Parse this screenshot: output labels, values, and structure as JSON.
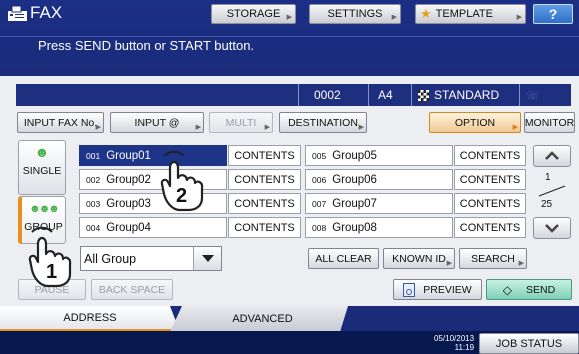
{
  "header": {
    "title": "FAX",
    "storage_label": "STORAGE",
    "settings_label": "SETTINGS",
    "template_label": "TEMPLATE",
    "help_label": "?",
    "message": "Press SEND button or START button."
  },
  "status": {
    "count": "0002",
    "paper": "A4",
    "resolution": "STANDARD"
  },
  "toolbar": {
    "input_fax_no": "INPUT FAX No.",
    "input_at": "INPUT @",
    "multi": "MULTI",
    "destination": "DESTINATION",
    "option": "OPTION",
    "monitor": "MONITOR"
  },
  "side_tabs": {
    "single": "SINGLE",
    "group": "GROUP"
  },
  "groups": [
    {
      "num": "001",
      "name": "Group01",
      "contents": "CONTENTS"
    },
    {
      "num": "005",
      "name": "Group05",
      "contents": "CONTENTS"
    },
    {
      "num": "002",
      "name": "Group02",
      "contents": "CONTENTS"
    },
    {
      "num": "006",
      "name": "Group06",
      "contents": "CONTENTS"
    },
    {
      "num": "003",
      "name": "Group03",
      "contents": "CONTENTS"
    },
    {
      "num": "007",
      "name": "Group07",
      "contents": "CONTENTS"
    },
    {
      "num": "004",
      "name": "Group04",
      "contents": "CONTENTS"
    },
    {
      "num": "008",
      "name": "Group08",
      "contents": "CONTENTS"
    }
  ],
  "pager": {
    "current": "1",
    "total": "25"
  },
  "filter": {
    "selected": "All Group"
  },
  "actions": {
    "all_clear": "ALL CLEAR",
    "known_id": "KNOWN ID",
    "search": "SEARCH",
    "pause": "PAUSE",
    "back_space": "BACK SPACE",
    "preview": "PREVIEW",
    "send": "SEND"
  },
  "tabs": {
    "address": "ADDRESS",
    "advanced": "ADVANCED"
  },
  "footer": {
    "date": "05/10/2013",
    "time": "11:19",
    "job_status": "JOB STATUS"
  },
  "callouts": {
    "one": "1",
    "two": "2"
  },
  "colors": {
    "header_bg": "#1b2f86",
    "selected_row": "#1d3488",
    "accent_orange": "#e8901f",
    "send_green": "#7fd0b6"
  }
}
